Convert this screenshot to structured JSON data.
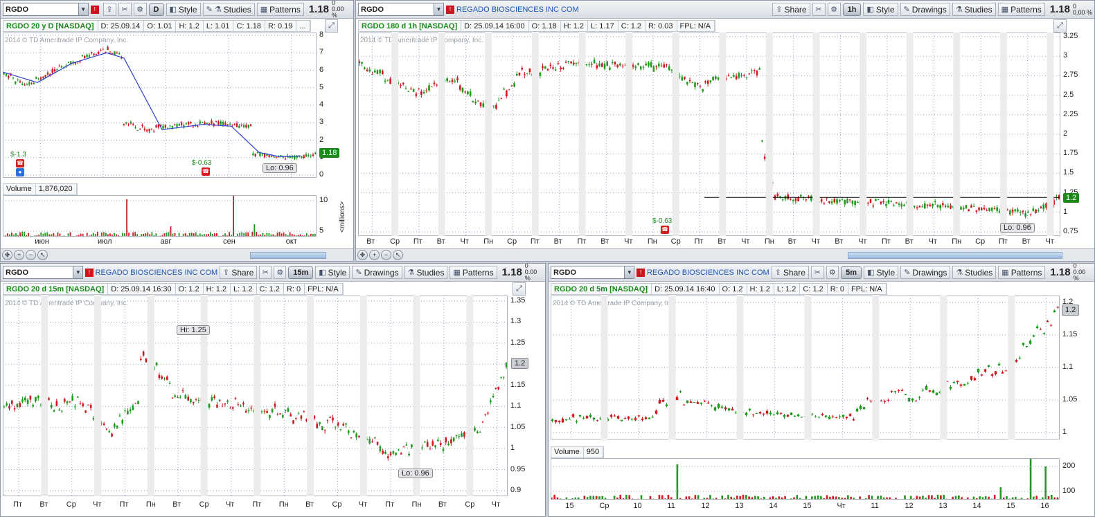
{
  "panels": {
    "p1": {
      "symbol": "RGDO",
      "company": "",
      "timeframe": "D",
      "buttons": {
        "style": "Style",
        "studies": "Studies",
        "patterns": "Patterns"
      },
      "price": "1.18",
      "change": "0",
      "change_pct": "0.00 %",
      "info": {
        "title": "RGDO 20 y D [NASDAQ]",
        "d": "D: 25.09.14",
        "o": "O: 1.01",
        "h": "H: 1.2",
        "l": "L: 1.01",
        "c": "C: 1.18",
        "r": "R: 0.19",
        "more": "..."
      },
      "copyright": "2014 © TD Ameritrade IP Company, Inc.",
      "last_badge": "1.18",
      "div_label1": "$-1.3",
      "div_label2": "$-0.63",
      "lo_tag": "Lo: 0.96",
      "volume": {
        "label": "Volume",
        "value": "1,876,020",
        "axis_unit": "<millions>"
      },
      "yticks": [
        "8",
        "7",
        "6",
        "5",
        "4",
        "3",
        "2",
        "1",
        "0"
      ],
      "vticks": [
        "10",
        "5"
      ],
      "xticks": [
        "июн",
        "июл",
        "авг",
        "сен",
        "окт"
      ]
    },
    "p2": {
      "symbol": "RGDO",
      "company": "REGADO BIOSCIENCES INC COM",
      "timeframe": "1h",
      "buttons": {
        "share": "Share",
        "style": "Style",
        "drawings": "Drawings",
        "studies": "Studies",
        "patterns": "Patterns"
      },
      "price": "1.18",
      "change": "0",
      "change_pct": "0.00 %",
      "info": {
        "title": "RGDO 180 d 1h [NASDAQ]",
        "d": "D: 25.09.14 16:00",
        "o": "O: 1.18",
        "h": "H: 1.2",
        "l": "L: 1.17",
        "c": "C: 1.2",
        "r": "R: 0.03",
        "fpl": "FPL: N/A"
      },
      "copyright": "2014 © TD Ameritrade IP Company, Inc.",
      "last_badge": "1.2",
      "div_label": "$-0.63",
      "lo_tag": "Lo: 0.96",
      "yticks": [
        "3.25",
        "3",
        "2.75",
        "2.5",
        "2.25",
        "2",
        "1.75",
        "1.5",
        "1.25",
        "1",
        "0.75"
      ],
      "xticks": [
        "Вт",
        "Ср",
        "Пт",
        "Вт",
        "Чт",
        "Пн",
        "Ср",
        "Пт",
        "Вт",
        "Пт",
        "Вт",
        "Чт",
        "Пн",
        "Ср",
        "Пт",
        "Вт",
        "Чт",
        "Пн",
        "Вт",
        "Чт",
        "Вт",
        "Чт",
        "Пт",
        "Вт",
        "Чт",
        "Пн",
        "Ср",
        "Пт",
        "Вт",
        "Чт"
      ]
    },
    "p3": {
      "symbol": "RGDO",
      "company": "REGADO BIOSCIENCES INC COM",
      "timeframe": "15m",
      "buttons": {
        "share": "Share",
        "style": "Style",
        "drawings": "Drawings",
        "studies": "Studies",
        "patterns": "Patterns"
      },
      "price": "1.18",
      "change": "0",
      "change_pct": "0.00 %",
      "info": {
        "title": "RGDO 20 d 15m [NASDAQ]",
        "d": "D: 25.09.14 16:30",
        "o": "O: 1.2",
        "h": "H: 1.2",
        "l": "L: 1.2",
        "c": "C: 1.2",
        "r": "R: 0",
        "fpl": "FPL: N/A"
      },
      "copyright": "2014 © TD Ameritrade IP Company, Inc.",
      "last_badge": "1.2",
      "hi_tag": "Hi: 1.25",
      "lo_tag": "Lo: 0.96",
      "yticks": [
        "1.35",
        "1.3",
        "1.25",
        "1.2",
        "1.15",
        "1.1",
        "1.05",
        "1",
        "0.95",
        "0.9"
      ],
      "xticks": [
        "Пт",
        "Вт",
        "Ср",
        "Чт",
        "Пт",
        "Пн",
        "Вт",
        "Ср",
        "Чт",
        "Пт",
        "Пн",
        "Вт",
        "Ср",
        "Чт",
        "Пт",
        "Пн",
        "Вт",
        "Ср",
        "Чт"
      ]
    },
    "p4": {
      "symbol": "RGDO",
      "company": "REGADO BIOSCIENCES INC COM",
      "timeframe": "5m",
      "buttons": {
        "share": "Share",
        "style": "Style",
        "drawings": "Drawings",
        "studies": "Studies",
        "patterns": "Patterns"
      },
      "price": "1.18",
      "change": "0",
      "change_pct": "0.00 %",
      "info": {
        "title": "RGDO 20 d 5m [NASDAQ]",
        "d": "D: 25.09.14 16:40",
        "o": "O: 1.2",
        "h": "H: 1.2",
        "l": "L: 1.2",
        "c": "C: 1.2",
        "r": "R: 0",
        "fpl": "FPL: N/A"
      },
      "copyright": "2014 © TD Ameritrade IP Company, Inc.",
      "last_badge": "1.2",
      "volume": {
        "label": "Volume",
        "value": "950"
      },
      "yticks": [
        "1.2",
        "1.15",
        "1.1",
        "1.05",
        "1"
      ],
      "vticks": [
        "200",
        "100"
      ],
      "xticks": [
        "15",
        "Ср",
        "10",
        "11",
        "12",
        "13",
        "14",
        "15",
        "Чт",
        "11",
        "12",
        "13",
        "14",
        "15",
        "16"
      ]
    }
  },
  "icons": {
    "dropdown": "chevron-down-icon",
    "share": "share-icon",
    "settings": "wrench-icon",
    "style": "style-icon",
    "drawings": "pencil-icon",
    "studies": "studies-icon",
    "patterns": "patterns-icon",
    "zoom_in": "zoom-in-icon",
    "zoom_out": "zoom-out-icon",
    "pointer": "pointer-icon"
  },
  "colors": {
    "up": "#1f9a1f",
    "down": "#d01b22",
    "sma": "#2a3fd0",
    "company_link": "#1a56b8",
    "badge_green": "#1b8a1b"
  }
}
